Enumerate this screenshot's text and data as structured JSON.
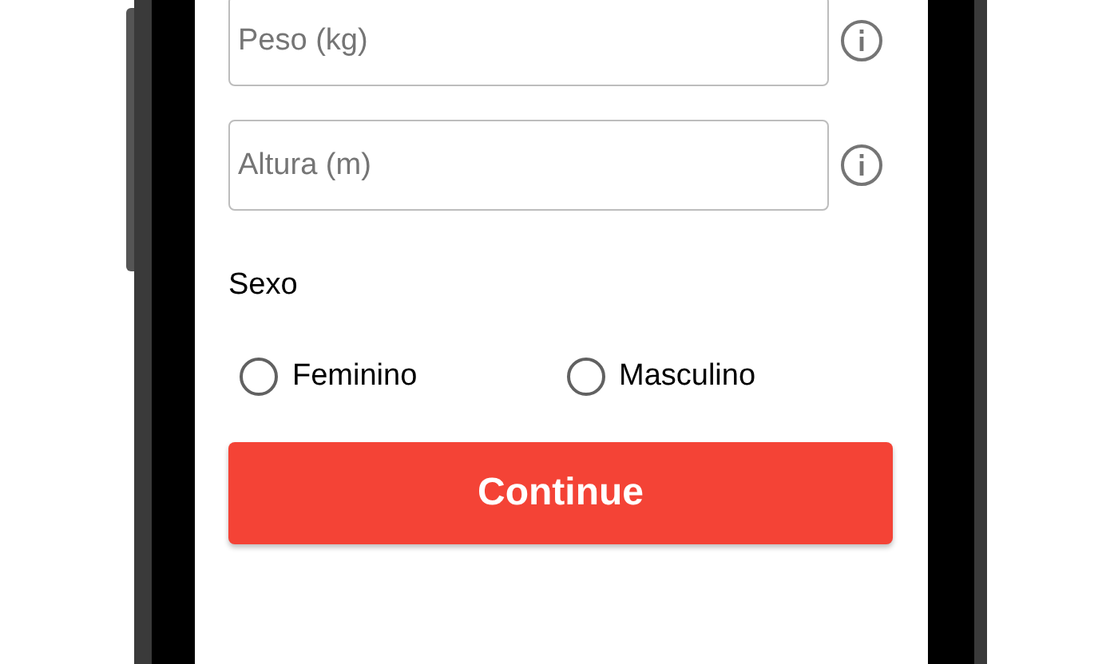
{
  "fields": [
    {
      "placeholder": "Peso (kg)"
    },
    {
      "placeholder": "Altura (m)"
    }
  ],
  "sex": {
    "label": "Sexo",
    "options": [
      {
        "label": "Feminino",
        "selected": false
      },
      {
        "label": "Masculino",
        "selected": false
      }
    ]
  },
  "button": {
    "label": "Continue"
  }
}
